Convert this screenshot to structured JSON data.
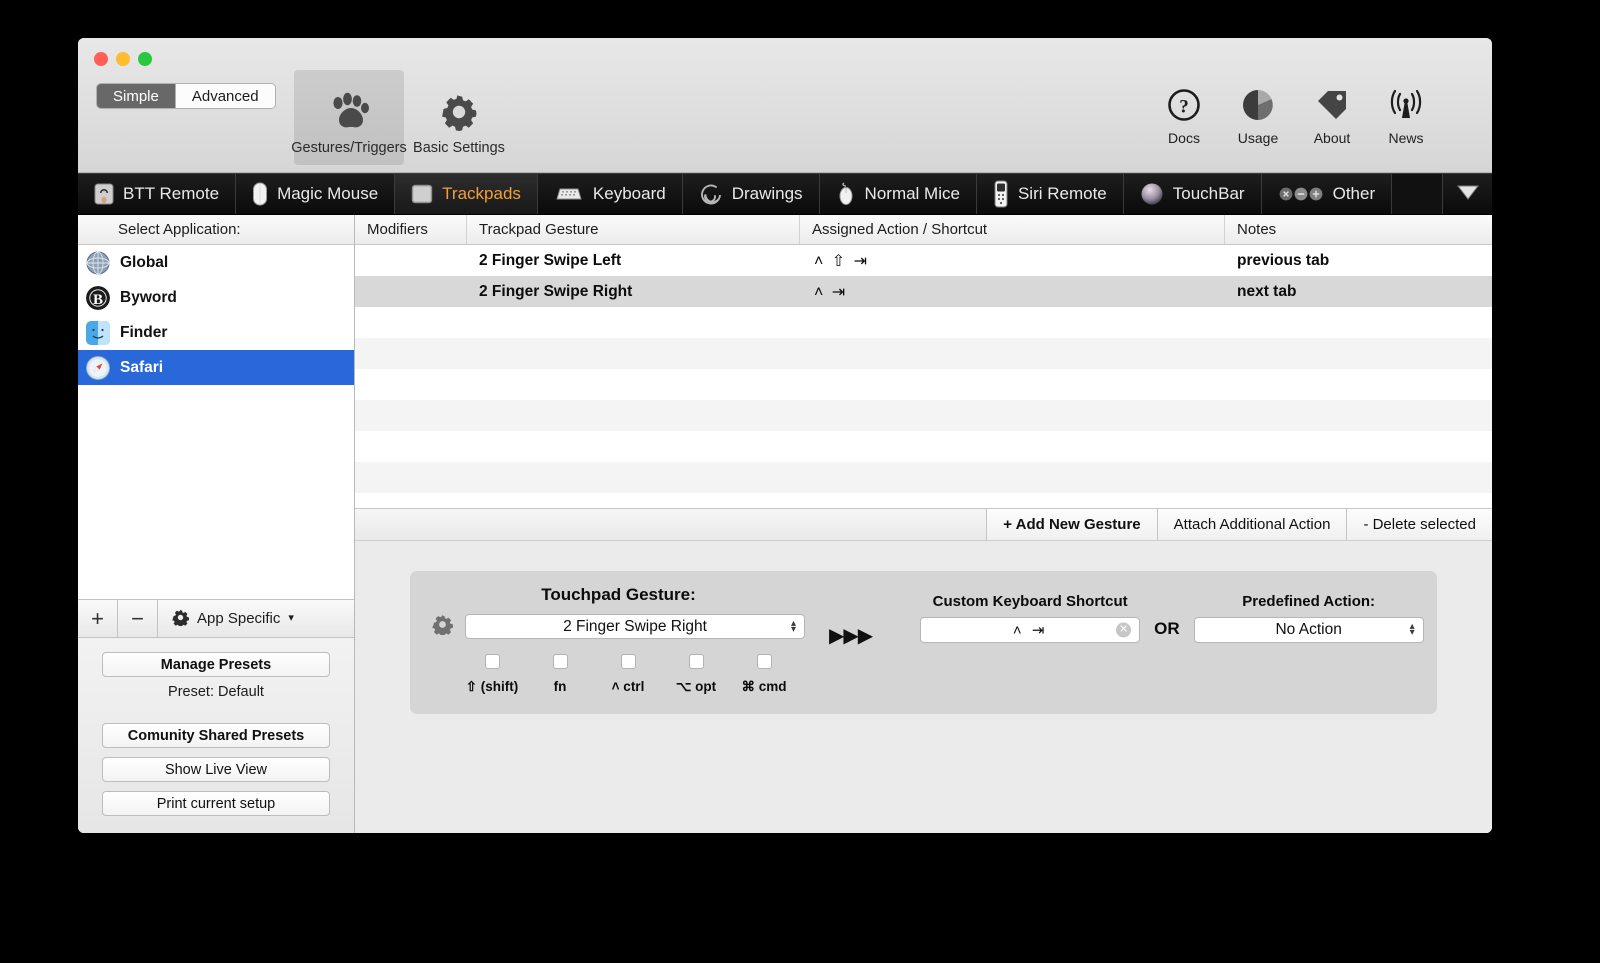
{
  "window": {
    "mode_toggle": {
      "options": [
        "Simple",
        "Advanced"
      ],
      "selected": "Simple"
    },
    "mode_buttons": [
      {
        "label": "Gestures/Triggers",
        "icon": "paw-icon",
        "selected": true
      },
      {
        "label": "Basic Settings",
        "icon": "gear-icon",
        "selected": false
      }
    ],
    "help_items": [
      {
        "label": "Docs",
        "icon": "question-circle-icon"
      },
      {
        "label": "Usage",
        "icon": "pie-chart-icon"
      },
      {
        "label": "About",
        "icon": "tag-icon"
      },
      {
        "label": "News",
        "icon": "broadcast-icon"
      }
    ]
  },
  "device_tabs": {
    "items": [
      {
        "label": "BTT Remote",
        "icon": "remote-icon",
        "active": false
      },
      {
        "label": "Magic Mouse",
        "icon": "magic-mouse-icon",
        "active": false
      },
      {
        "label": "Trackpads",
        "icon": "trackpad-icon",
        "active": true
      },
      {
        "label": "Keyboard",
        "icon": "keyboard-icon",
        "active": false
      },
      {
        "label": "Drawings",
        "icon": "spiral-icon",
        "active": false
      },
      {
        "label": "Normal Mice",
        "icon": "mouse-icon",
        "active": false
      },
      {
        "label": "Siri Remote",
        "icon": "siri-remote-icon",
        "active": false
      },
      {
        "label": "TouchBar",
        "icon": "touchbar-icon",
        "active": false
      },
      {
        "label": "Other",
        "icon": "other-dots-icon",
        "active": false
      }
    ],
    "overflow_icon": "chevron-down-icon"
  },
  "sidebar": {
    "header": "Select Application:",
    "apps": [
      {
        "label": "Global",
        "icon": "globe-icon",
        "selected": false
      },
      {
        "label": "Byword",
        "icon": "byword-icon",
        "selected": false
      },
      {
        "label": "Finder",
        "icon": "finder-icon",
        "selected": false
      },
      {
        "label": "Safari",
        "icon": "safari-icon",
        "selected": true
      }
    ],
    "tools": {
      "add": "+",
      "remove": "−",
      "app_specific": "App Specific",
      "app_specific_caret": "▾",
      "gear_icon": "gear-icon"
    },
    "presets": {
      "manage": "Manage Presets",
      "current": "Preset: Default",
      "community": "Comunity Shared Presets",
      "live_view": "Show Live View",
      "print": "Print current setup"
    }
  },
  "table": {
    "columns": [
      "Modifiers",
      "Trackpad Gesture",
      "Assigned Action / Shortcut",
      "Notes"
    ],
    "rows": [
      {
        "modifiers": "",
        "gesture": "2 Finger Swipe Left",
        "action": "˄ ⇧ ⇥",
        "notes": "previous tab",
        "selected": false
      },
      {
        "modifiers": "",
        "gesture": "2 Finger Swipe Right",
        "action": "˄ ⇥",
        "notes": "next tab",
        "selected": true
      }
    ],
    "empty_row_count": 13
  },
  "actions": {
    "add": "+ Add New Gesture",
    "attach": "Attach Additional Action",
    "delete": "- Delete selected"
  },
  "config": {
    "gesture_title": "Touchpad Gesture:",
    "gesture_value": "2 Finger Swipe Right",
    "gesture_gear_icon": "gear-icon",
    "modifiers": [
      {
        "label": "⇧ (shift)",
        "checked": false
      },
      {
        "label": "fn",
        "checked": false
      },
      {
        "label": "˄ ctrl",
        "checked": false
      },
      {
        "label": "⌥ opt",
        "checked": false
      },
      {
        "label": "⌘ cmd",
        "checked": false
      }
    ],
    "arrows": "▶▶▶",
    "shortcut_label": "Custom Keyboard Shortcut",
    "shortcut_value": "˄ ⇥",
    "shortcut_clear_icon": "clear-circle-icon",
    "or_label": "OR",
    "predefined_label": "Predefined Action:",
    "predefined_value": "No Action",
    "stepper_up": "▴",
    "stepper_down": "▾"
  },
  "colors": {
    "accent_selected": "#2868d8",
    "tab_active_text": "#f0a03c",
    "devbar_bg": "#111111"
  }
}
